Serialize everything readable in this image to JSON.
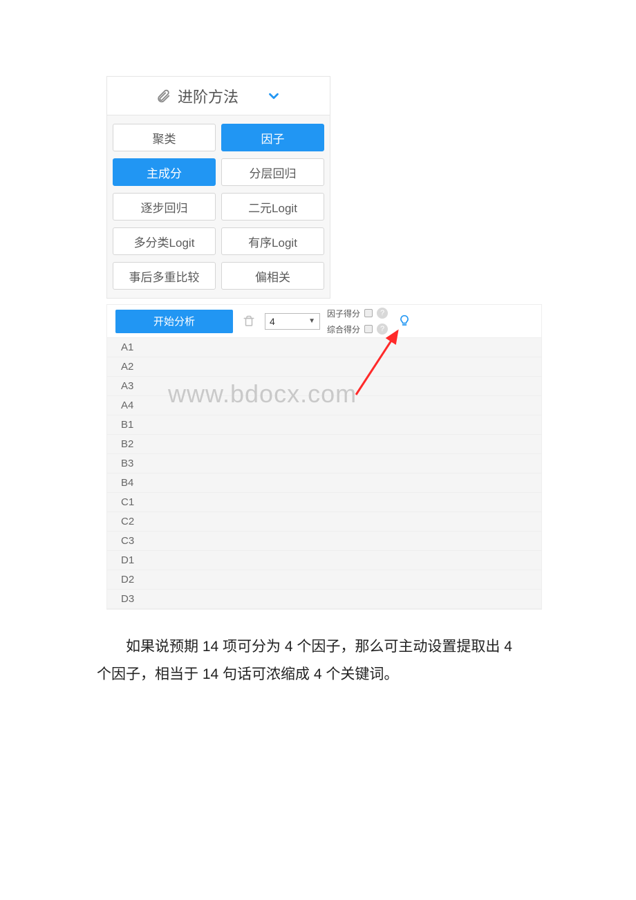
{
  "panel": {
    "title": "进阶方法",
    "methods": [
      {
        "label": "聚类",
        "active": false
      },
      {
        "label": "因子",
        "active": true
      },
      {
        "label": "主成分",
        "active": true
      },
      {
        "label": "分层回归",
        "active": false
      },
      {
        "label": "逐步回归",
        "active": false
      },
      {
        "label": "二元Logit",
        "active": false
      },
      {
        "label": "多分类Logit",
        "active": false
      },
      {
        "label": "有序Logit",
        "active": false
      },
      {
        "label": "事后多重比较",
        "active": false
      },
      {
        "label": "偏相关",
        "active": false
      }
    ]
  },
  "analysis": {
    "start_label": "开始分析",
    "factor_count": "4",
    "factor_score_label": "因子得分",
    "composite_score_label": "综合得分",
    "variables": [
      "A1",
      "A2",
      "A3",
      "A4",
      "B1",
      "B2",
      "B3",
      "B4",
      "C1",
      "C2",
      "C3",
      "D1",
      "D2",
      "D3"
    ]
  },
  "watermark": "www.bdocx.com",
  "paragraph": "如果说预期 14 项可分为 4 个因子，那么可主动设置提取出 4 个因子，相当于 14 句话可浓缩成 4 个关键词。"
}
